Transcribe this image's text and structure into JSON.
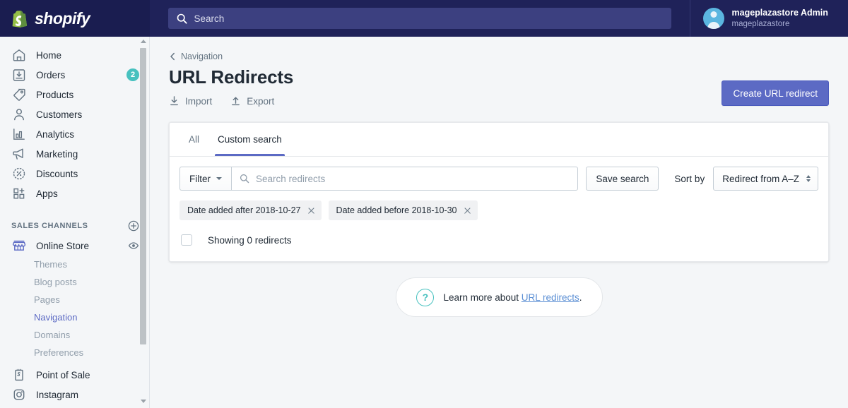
{
  "topbar": {
    "brand_name": "shopify",
    "brand_icon": "shopify-bag-icon",
    "search": {
      "placeholder": "Search",
      "icon": "search-icon",
      "value": ""
    },
    "user": {
      "name": "mageplazastore Admin",
      "store": "mageplazastore",
      "avatar_icon": "user-avatar-icon"
    }
  },
  "sidebar": {
    "items": [
      {
        "label": "Home",
        "icon": "home-icon",
        "badge": ""
      },
      {
        "label": "Orders",
        "icon": "orders-icon",
        "badge": "2"
      },
      {
        "label": "Products",
        "icon": "products-tag-icon",
        "badge": ""
      },
      {
        "label": "Customers",
        "icon": "customers-icon",
        "badge": ""
      },
      {
        "label": "Analytics",
        "icon": "analytics-bar-icon",
        "badge": ""
      },
      {
        "label": "Marketing",
        "icon": "marketing-megaphone-icon",
        "badge": ""
      },
      {
        "label": "Discounts",
        "icon": "discounts-percent-icon",
        "badge": ""
      },
      {
        "label": "Apps",
        "icon": "apps-grid-icon",
        "badge": ""
      }
    ],
    "section": {
      "title": "SALES CHANNELS",
      "add_icon": "plus-circle-icon"
    },
    "online_store": {
      "label": "Online Store",
      "icon": "online-store-icon",
      "view_icon": "eye-icon"
    },
    "sub_items": [
      {
        "label": "Themes",
        "active": false
      },
      {
        "label": "Blog posts",
        "active": false
      },
      {
        "label": "Pages",
        "active": false
      },
      {
        "label": "Navigation",
        "active": true
      },
      {
        "label": "Domains",
        "active": false
      },
      {
        "label": "Preferences",
        "active": false
      }
    ],
    "channels": [
      {
        "label": "Point of Sale",
        "icon": "point-of-sale-icon"
      },
      {
        "label": "Instagram",
        "icon": "instagram-icon"
      }
    ],
    "accent_color": "#5c6ac4",
    "badge_color": "#47c1bf"
  },
  "page": {
    "breadcrumb": {
      "label": "Navigation",
      "icon": "chevron-left-icon"
    },
    "title": "URL Redirects",
    "actions": [
      {
        "label": "Import",
        "icon": "import-download-icon"
      },
      {
        "label": "Export",
        "icon": "export-upload-icon"
      }
    ],
    "primary_button": {
      "label": "Create URL redirect",
      "color": "#5c6ac4"
    }
  },
  "card": {
    "tabs": [
      {
        "label": "All",
        "active": false
      },
      {
        "label": "Custom search",
        "active": true
      }
    ],
    "filter": {
      "button_label": "Filter",
      "caret_icon": "chevron-down-icon",
      "search_placeholder": "Search redirects",
      "search_value": "",
      "search_icon": "search-icon",
      "save_label": "Save search"
    },
    "sort": {
      "label": "Sort by",
      "selected": "Redirect from A–Z",
      "spinner_icon": "select-updown-icon"
    },
    "tags": [
      {
        "label": "Date added after 2018-10-27",
        "remove_icon": "close-icon"
      },
      {
        "label": "Date added before 2018-10-30",
        "remove_icon": "close-icon"
      }
    ],
    "showing": {
      "text": "Showing 0 redirects",
      "checkbox_checked": false
    }
  },
  "help": {
    "icon": "question-circle-icon",
    "text": "Learn more about ",
    "link": "URL redirects",
    "suffix": ".",
    "link_color": "#5b8fd4"
  }
}
